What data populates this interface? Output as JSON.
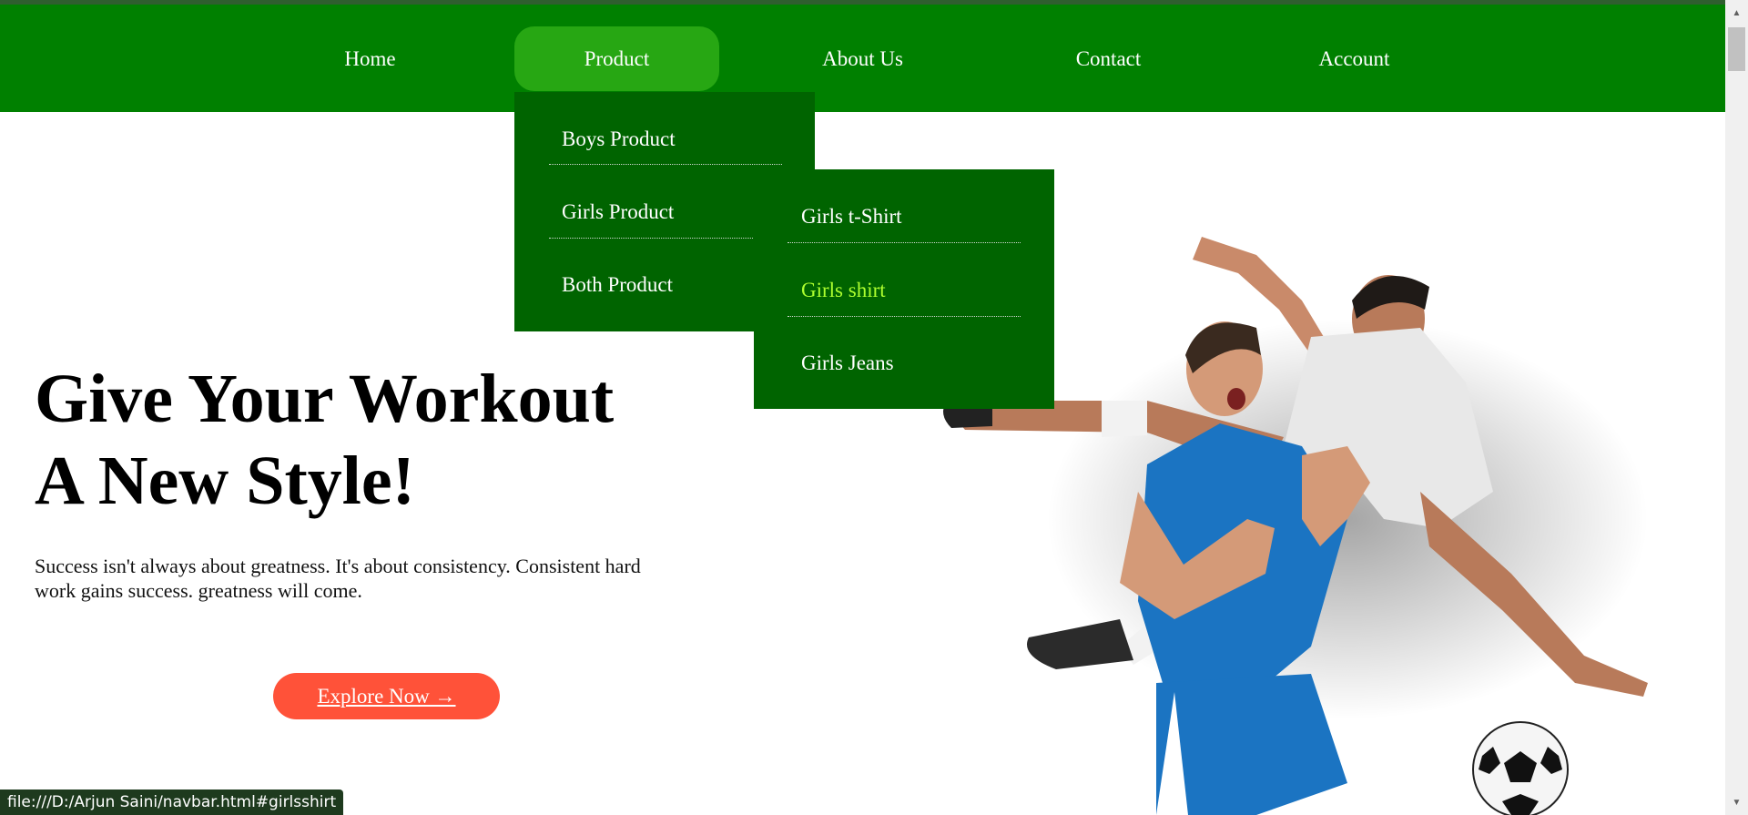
{
  "navbar": {
    "items": [
      {
        "label": "Home"
      },
      {
        "label": "Product"
      },
      {
        "label": "About Us"
      },
      {
        "label": "Contact"
      },
      {
        "label": "Account"
      }
    ],
    "active": "Product"
  },
  "product_dropdown": {
    "items": [
      {
        "label": "Boys Product"
      },
      {
        "label": "Girls Product"
      },
      {
        "label": "Both Product"
      }
    ]
  },
  "girls_submenu": {
    "items": [
      {
        "label": "Girls t-Shirt"
      },
      {
        "label": "Girls shirt"
      },
      {
        "label": "Girls Jeans"
      }
    ],
    "hovered": "Girls shirt"
  },
  "hero": {
    "title_line1": "Give Your Workout",
    "title_line2": "A New Style!",
    "description": "Success isn't always about greatness. It's about consistency. Consistent hard work gains success. greatness will come.",
    "button_label": "Explore Now →"
  },
  "status_bar": {
    "url": "file:///D:/Arjun Saini/navbar.html#girlsshirt"
  },
  "colors": {
    "navbar": "#008000",
    "nav_active": "#27a713",
    "dropdown": "#006400",
    "submenu_hover_text": "#adff2f",
    "button": "#ff5239"
  },
  "icons": [
    "scroll-up-arrow-icon",
    "scroll-down-arrow-icon"
  ]
}
